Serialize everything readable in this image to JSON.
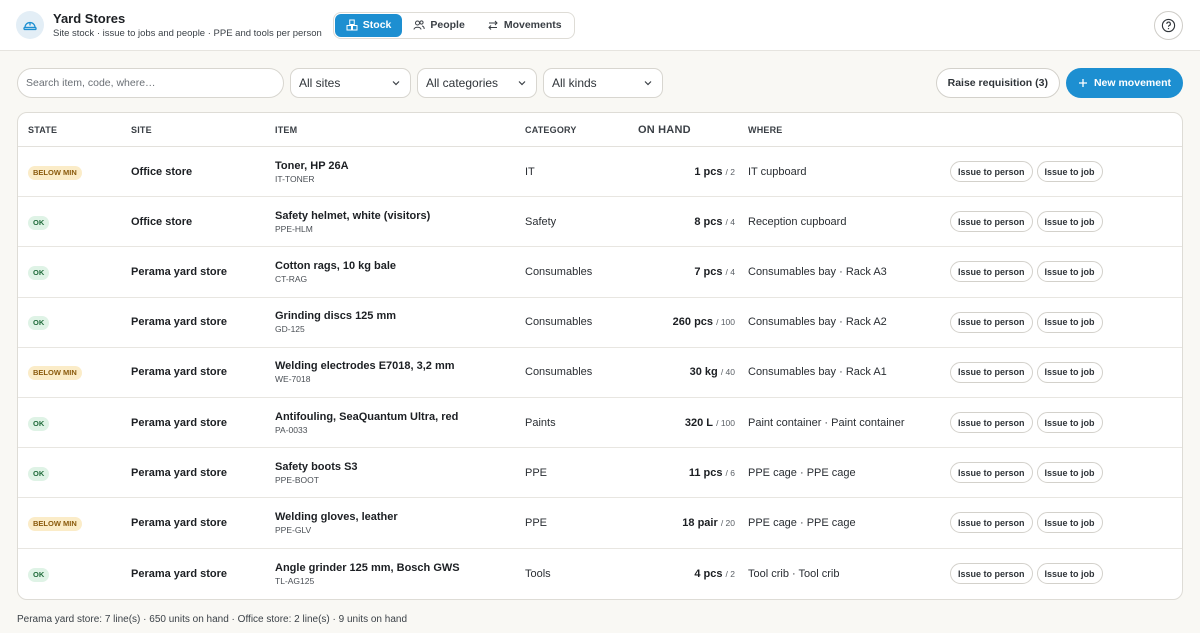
{
  "app": {
    "title": "Yard Stores",
    "subtitle": "Site stock · issue to jobs and people · PPE and tools per person",
    "logo_icon": "hard-hat-icon"
  },
  "tabs": [
    {
      "label": "Stock",
      "icon": "boxes-icon",
      "active": true
    },
    {
      "label": "People",
      "icon": "people-icon",
      "active": false
    },
    {
      "label": "Movements",
      "icon": "swap-arrows-icon",
      "active": false
    }
  ],
  "help_icon": "question-circle-icon",
  "toolbar": {
    "search_placeholder": "Search item, code, where…",
    "site_filter": "All sites",
    "category_filter": "All categories",
    "kind_filter": "All kinds",
    "raise_requisition": "Raise requisition (3)",
    "new_movement": "New movement"
  },
  "colors": {
    "accent": "#1d8fd1",
    "ok_bg": "#dff3e6",
    "below_min_bg": "#fbecc8"
  },
  "table": {
    "headers": {
      "state": "STATE",
      "site": "SITE",
      "item": "ITEM",
      "category": "CATEGORY",
      "on_hand": "ON HAND",
      "where": "WHERE"
    },
    "action_labels": {
      "issue_person": "Issue to person",
      "issue_job": "Issue to job"
    },
    "rows": [
      {
        "state": "BELOW MIN",
        "state_kind": "low",
        "site": "Office store",
        "item": "Toner, HP 26A",
        "code": "IT-TONER",
        "category": "IT",
        "qty": "1 pcs",
        "min": "/ 2",
        "where": "IT cupboard"
      },
      {
        "state": "OK",
        "state_kind": "ok",
        "site": "Office store",
        "item": "Safety helmet, white (visitors)",
        "code": "PPE-HLM",
        "category": "Safety",
        "qty": "8 pcs",
        "min": "/ 4",
        "where": "Reception cupboard"
      },
      {
        "state": "OK",
        "state_kind": "ok",
        "site": "Perama yard store",
        "item": "Cotton rags, 10 kg bale",
        "code": "CT-RAG",
        "category": "Consumables",
        "qty": "7 pcs",
        "min": "/ 4",
        "where": "Consumables bay · Rack A3"
      },
      {
        "state": "OK",
        "state_kind": "ok",
        "site": "Perama yard store",
        "item": "Grinding discs 125 mm",
        "code": "GD-125",
        "category": "Consumables",
        "qty": "260 pcs",
        "min": "/ 100",
        "where": "Consumables bay · Rack A2"
      },
      {
        "state": "BELOW MIN",
        "state_kind": "low",
        "site": "Perama yard store",
        "item": "Welding electrodes E7018, 3,2 mm",
        "code": "WE-7018",
        "category": "Consumables",
        "qty": "30 kg",
        "min": "/ 40",
        "where": "Consumables bay · Rack A1"
      },
      {
        "state": "OK",
        "state_kind": "ok",
        "site": "Perama yard store",
        "item": "Antifouling, SeaQuantum Ultra, red",
        "code": "PA-0033",
        "category": "Paints",
        "qty": "320 L",
        "min": "/ 100",
        "where": "Paint container · Paint container"
      },
      {
        "state": "OK",
        "state_kind": "ok",
        "site": "Perama yard store",
        "item": "Safety boots S3",
        "code": "PPE-BOOT",
        "category": "PPE",
        "qty": "11 pcs",
        "min": "/ 6",
        "where": "PPE cage · PPE cage"
      },
      {
        "state": "BELOW MIN",
        "state_kind": "low",
        "site": "Perama yard store",
        "item": "Welding gloves, leather",
        "code": "PPE-GLV",
        "category": "PPE",
        "qty": "18 pair",
        "min": "/ 20",
        "where": "PPE cage · PPE cage"
      },
      {
        "state": "OK",
        "state_kind": "ok",
        "site": "Perama yard store",
        "item": "Angle grinder 125 mm, Bosch GWS",
        "code": "TL-AG125",
        "category": "Tools",
        "qty": "4 pcs",
        "min": "/ 2",
        "where": "Tool crib · Tool crib"
      }
    ]
  },
  "footer": {
    "summary": "Perama yard store: 7 line(s) · 650 units on hand · Office store: 2 line(s) · 9 units on hand"
  }
}
